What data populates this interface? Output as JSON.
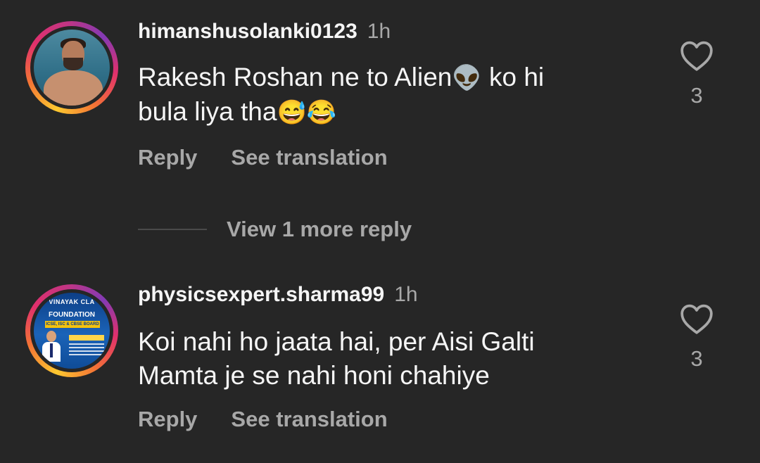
{
  "comments": [
    {
      "username": "himanshusolanki0123",
      "time": "1h",
      "text_line1": "Rakesh Roshan ne to Alien",
      "emoji_alien": "👽",
      "text_line1_end": " ko hi",
      "text_line2": "bula liya tha",
      "emoji_sweat": "😅",
      "emoji_joy": "😂",
      "reply_label": "Reply",
      "translate_label": "See translation",
      "like_count": "3"
    },
    {
      "username": "physicsexpert.sharma99",
      "time": "1h",
      "text_line1": "Koi nahi ho jaata hai, per Aisi Galti",
      "text_line2": "Mamta je se nahi honi chahiye",
      "reply_label": "Reply",
      "translate_label": "See translation",
      "like_count": "3",
      "avatar": {
        "title": "VINAYAK CLA",
        "sub": "FOUNDATION",
        "band": "ICSE, ISC & CBSE BOARD"
      }
    }
  ],
  "view_more_replies": "View 1 more reply",
  "colors": {
    "background": "#262626",
    "text_primary": "#f5f5f5",
    "text_secondary": "#a8a8a8"
  }
}
